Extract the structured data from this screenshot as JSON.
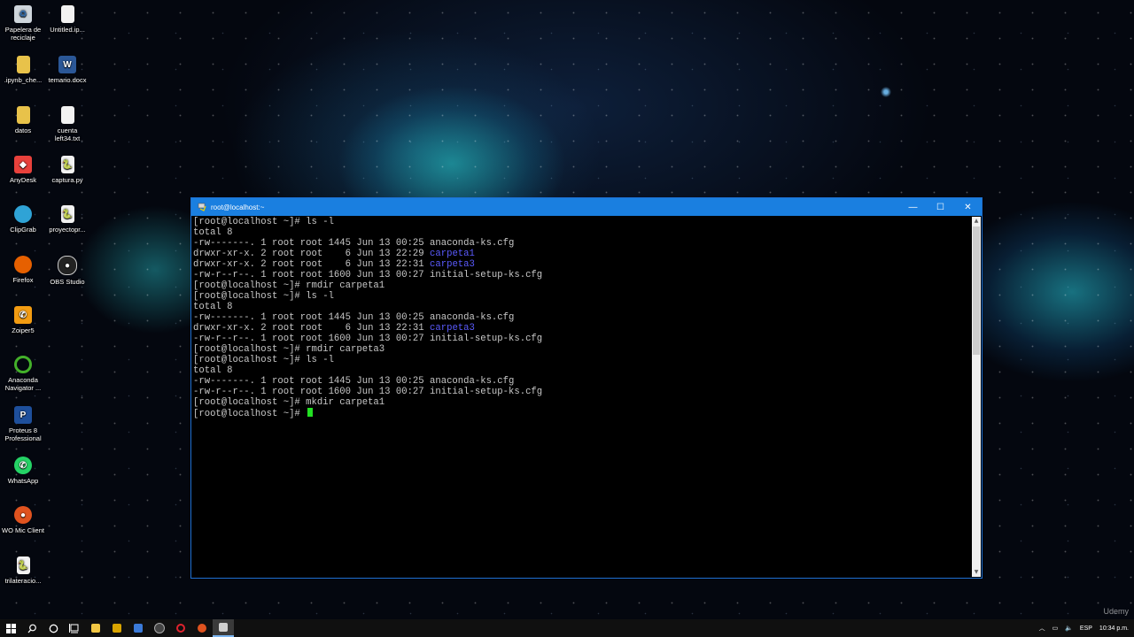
{
  "desktop": {
    "icons": [
      {
        "label": "Papelera de reciclaje"
      },
      {
        "label": "Untitled.ip..."
      },
      {
        "label": ".ipynb_che..."
      },
      {
        "label": "temario.docx"
      },
      {
        "label": "datos"
      },
      {
        "label": "cuenta left34.txt"
      },
      {
        "label": "AnyDesk"
      },
      {
        "label": "captura.py"
      },
      {
        "label": "ClipGrab"
      },
      {
        "label": "proyectopr..."
      },
      {
        "label": "Firefox"
      },
      {
        "label": "OBS Studio"
      },
      {
        "label": "Zoiper5"
      },
      {
        "label": "Anaconda Navigator ..."
      },
      {
        "label": "Proteus 8 Professional"
      },
      {
        "label": "WhatsApp"
      },
      {
        "label": "WO Mic Client"
      },
      {
        "label": "trilateracio..."
      }
    ]
  },
  "window": {
    "title": "root@localhost:~",
    "minimize": "—",
    "maximize": "☐",
    "close": "✕"
  },
  "terminal": {
    "lines": [
      {
        "text": "[root@localhost ~]# ls -l"
      },
      {
        "text": "total 8"
      },
      {
        "text": "-rw-------. 1 root root 1445 Jun 13 00:25 anaconda-ks.cfg"
      },
      {
        "text": "drwxr-xr-x. 2 root root    6 Jun 13 22:29 ",
        "dir": "carpeta1"
      },
      {
        "text": "drwxr-xr-x. 2 root root    6 Jun 13 22:31 ",
        "dir": "carpeta3"
      },
      {
        "text": "-rw-r--r--. 1 root root 1600 Jun 13 00:27 initial-setup-ks.cfg"
      },
      {
        "text": "[root@localhost ~]# rmdir carpeta1"
      },
      {
        "text": "[root@localhost ~]# ls -l"
      },
      {
        "text": "total 8"
      },
      {
        "text": "-rw-------. 1 root root 1445 Jun 13 00:25 anaconda-ks.cfg"
      },
      {
        "text": "drwxr-xr-x. 2 root root    6 Jun 13 22:31 ",
        "dir": "carpeta3"
      },
      {
        "text": "-rw-r--r--. 1 root root 1600 Jun 13 00:27 initial-setup-ks.cfg"
      },
      {
        "text": "[root@localhost ~]# rmdir carpeta3"
      },
      {
        "text": "[root@localhost ~]# ls -l"
      },
      {
        "text": "total 8"
      },
      {
        "text": "-rw-------. 1 root root 1445 Jun 13 00:25 anaconda-ks.cfg"
      },
      {
        "text": "-rw-r--r--. 1 root root 1600 Jun 13 00:27 initial-setup-ks.cfg"
      },
      {
        "text": "[root@localhost ~]# mkdir carpeta1"
      }
    ],
    "prompt": "[root@localhost ~]# ",
    "colors": {
      "text": "#c8c8c8",
      "directory": "#5b5bff",
      "cursor": "#22e022"
    }
  },
  "taskbar": {
    "tray": {
      "language": "ESP",
      "time": "10:34 p.m."
    }
  },
  "watermark": "Udemy"
}
